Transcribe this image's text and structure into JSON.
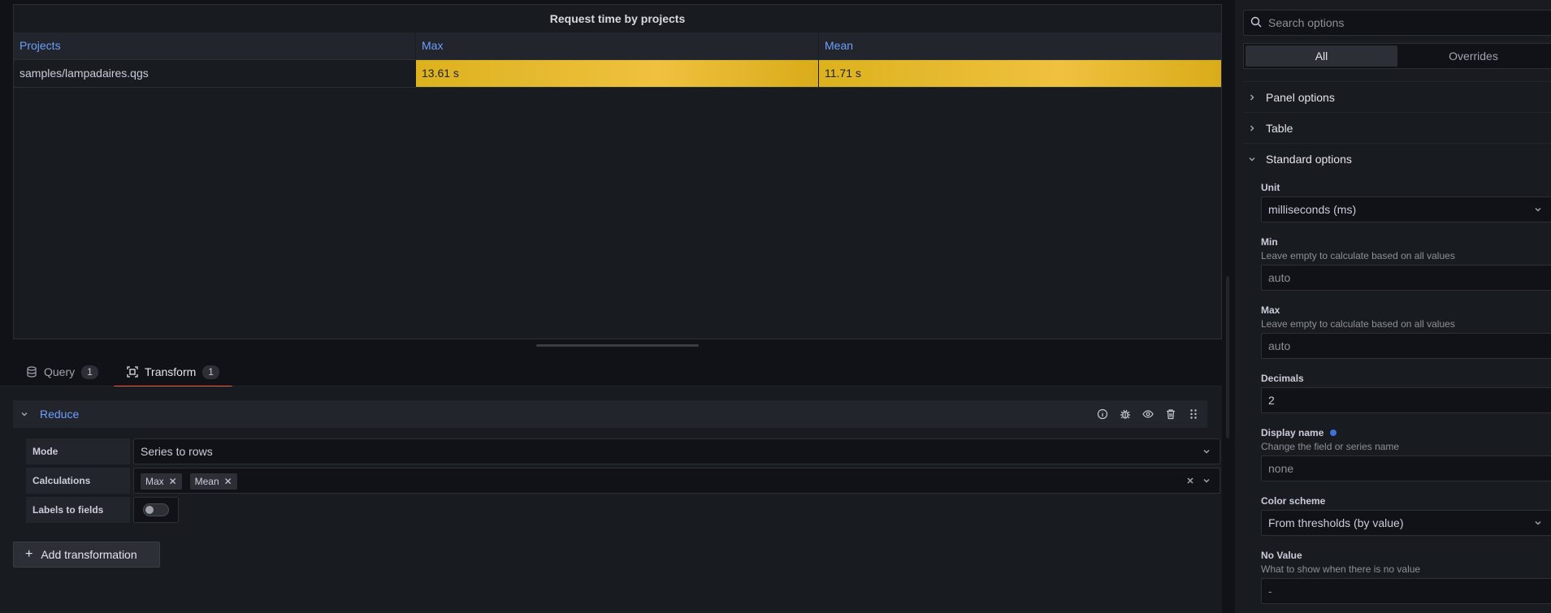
{
  "panel": {
    "title": "Request time by projects",
    "table": {
      "headers": [
        "Projects",
        "Max",
        "Mean"
      ],
      "rows": [
        [
          "samples/lampadaires.qgs",
          "13.61 s",
          "11.71 s"
        ]
      ]
    }
  },
  "tabs": [
    {
      "label": "Query",
      "count": "1"
    },
    {
      "label": "Transform",
      "count": "1"
    }
  ],
  "transform": {
    "title": "Reduce",
    "mode_label": "Mode",
    "mode_value": "Series to rows",
    "calculations_label": "Calculations",
    "calculations": [
      "Max",
      "Mean"
    ],
    "labels_to_fields_label": "Labels to fields",
    "add_label": "Add transformation"
  },
  "options": {
    "search_placeholder": "Search options",
    "seg_all": "All",
    "seg_overrides": "Overrides",
    "categories": {
      "panel": "Panel options",
      "table": "Table",
      "standard": "Standard options"
    },
    "unit": {
      "label": "Unit",
      "value": "milliseconds (ms)"
    },
    "min": {
      "label": "Min",
      "desc": "Leave empty to calculate based on all values",
      "placeholder": "auto"
    },
    "max": {
      "label": "Max",
      "desc": "Leave empty to calculate based on all values",
      "placeholder": "auto"
    },
    "decimals": {
      "label": "Decimals",
      "value": "2"
    },
    "display_name": {
      "label": "Display name",
      "desc": "Change the field or series name",
      "placeholder": "none"
    },
    "color_scheme": {
      "label": "Color scheme",
      "value": "From thresholds (by value)"
    },
    "no_value": {
      "label": "No Value",
      "desc": "What to show when there is no value",
      "placeholder": "-"
    }
  },
  "colors": {
    "accent_blue": "#6e9fff",
    "tab_active": "#f55f3e",
    "cell_yellow": "#e5b92b"
  }
}
